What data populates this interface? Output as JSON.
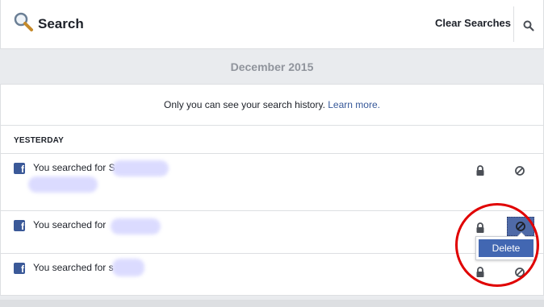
{
  "header": {
    "title": "Search",
    "clear_label": "Clear Searches"
  },
  "month": "December 2015",
  "privacy": {
    "text": "Only you can see your search history.",
    "link": "Learn more."
  },
  "section": {
    "label": "YESTERDAY"
  },
  "rows": [
    {
      "text": "You searched for",
      "visible_fragment": "S"
    },
    {
      "text": "You searched for",
      "visible_fragment": ""
    },
    {
      "text": "You searched for",
      "visible_fragment": "s"
    }
  ],
  "menu": {
    "delete_label": "Delete"
  },
  "colors": {
    "facebook_blue": "#3b5998",
    "link_blue": "#365899",
    "menu_highlight": "#4267b2",
    "annotation_red": "#e00000"
  },
  "icons": {
    "header": "magnifier-icon",
    "search": "search-icon",
    "lock": "lock-icon",
    "hide": "hide-icon",
    "source": "facebook-icon"
  }
}
